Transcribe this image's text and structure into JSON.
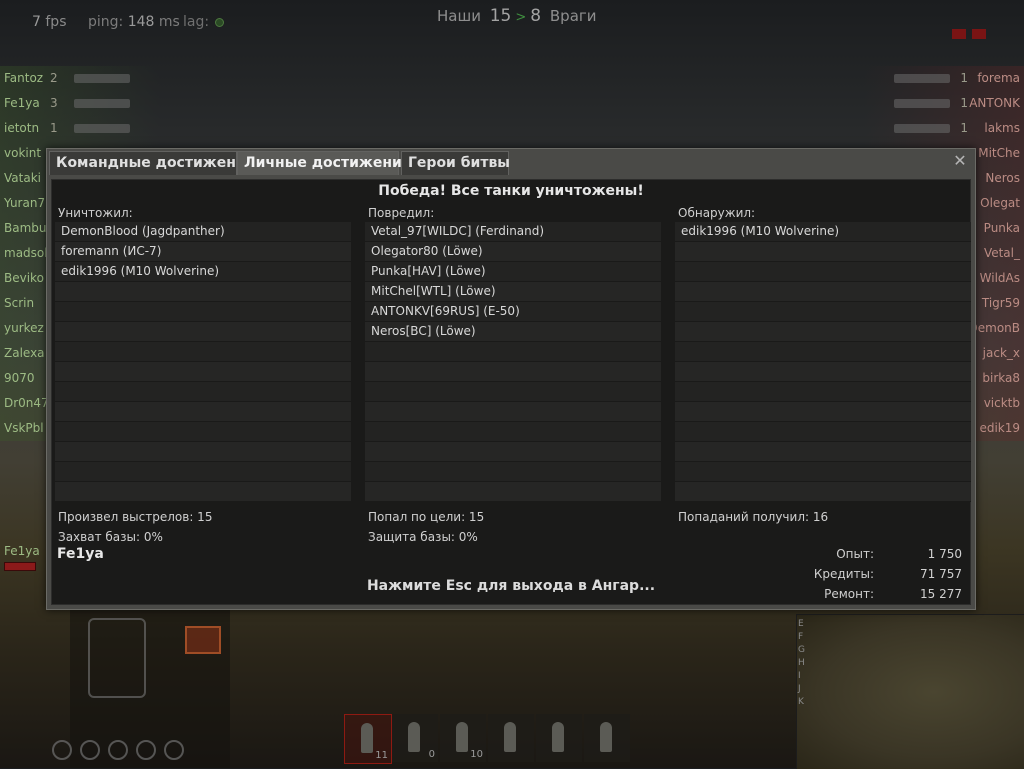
{
  "hud": {
    "fps_value": "7",
    "fps_label": "fps",
    "ping_label": "ping:",
    "ping_value": "148",
    "ping_unit": "ms",
    "lag_label": "lag:",
    "score_allies_label": "Наши",
    "score_allies": "15",
    "score_arrow": ">",
    "score_enemies": "8",
    "score_enemies_label": "Враги"
  },
  "allies": [
    {
      "name": "Fantoz",
      "frags": "2"
    },
    {
      "name": "Fe1ya",
      "frags": "3"
    },
    {
      "name": "ietotn",
      "frags": "1"
    },
    {
      "name": "vokint",
      "frags": ""
    },
    {
      "name": "Vataki",
      "frags": ""
    },
    {
      "name": "Yuran7",
      "frags": ""
    },
    {
      "name": "Bambuk",
      "frags": ""
    },
    {
      "name": "madsol",
      "frags": ""
    },
    {
      "name": "Beviko",
      "frags": ""
    },
    {
      "name": "Scrin",
      "frags": ""
    },
    {
      "name": "yurkez",
      "frags": ""
    },
    {
      "name": "Zalexa",
      "frags": ""
    },
    {
      "name": "9070",
      "frags": ""
    },
    {
      "name": "Dr0n47",
      "frags": ""
    },
    {
      "name": "VskPbl",
      "frags": ""
    }
  ],
  "enemies": [
    {
      "name": "forema",
      "frags": "1"
    },
    {
      "name": "ANTONK",
      "frags": "1"
    },
    {
      "name": "lakms",
      "frags": "1"
    },
    {
      "name": "MitChe",
      "frags": ""
    },
    {
      "name": "Neros",
      "frags": ""
    },
    {
      "name": "Olegat",
      "frags": ""
    },
    {
      "name": "Punka",
      "frags": ""
    },
    {
      "name": "Vetal_",
      "frags": ""
    },
    {
      "name": "WildAs",
      "frags": ""
    },
    {
      "name": "Tigr59",
      "frags": ""
    },
    {
      "name": "DemonB",
      "frags": ""
    },
    {
      "name": "jack_x",
      "frags": ""
    },
    {
      "name": "birka8",
      "frags": ""
    },
    {
      "name": "vicktb",
      "frags": ""
    },
    {
      "name": "edik19",
      "frags": ""
    }
  ],
  "own_vehicle_name": "Fe1ya",
  "ammo": [
    {
      "count": "11",
      "active": true
    },
    {
      "count": "0",
      "active": false
    },
    {
      "count": "10",
      "active": false
    },
    {
      "count": "",
      "active": false
    },
    {
      "count": "",
      "active": false
    },
    {
      "count": "",
      "active": false
    }
  ],
  "minimap_letters": [
    "E",
    "F",
    "G",
    "H",
    "I",
    "J",
    "K"
  ],
  "dialog": {
    "tabs": [
      "Командные достижения",
      "Личные достижения",
      "Герои битвы"
    ],
    "active_tab": 1,
    "close_glyph": "✕",
    "result_title": "Победа! Все танки уничтожены!",
    "destroyed_label": "Уничтожил:",
    "destroyed": [
      "DemonBlood (Jagdpanther)",
      "foremann (ИС-7)",
      "edik1996 (M10 Wolverine)"
    ],
    "damaged_label": "Повредил:",
    "damaged": [
      "Vetal_97[WILDC] (Ferdinand)",
      "Olegator80 (Löwe)",
      "Punka[HAV] (Löwe)",
      "MitChel[WTL] (Löwe)",
      "ANTONKV[69RUS] (E-50)",
      "Neros[BC] (Löwe)"
    ],
    "spotted_label": "Обнаружил:",
    "spotted": [
      "edik1996 (M10 Wolverine)"
    ],
    "shots_fired": "Произвел выстрелов: 15",
    "base_capture": "Захват базы: 0%",
    "hits": "Попал по цели: 15",
    "base_defense": "Защита базы: 0%",
    "hits_received": "Попаданий получил: 16",
    "player_name": "Fe1ya",
    "experience_label": "Опыт:",
    "experience_value": "1 750",
    "credits_label": "Кредиты:",
    "credits_value": "71 757",
    "repair_label": "Ремонт:",
    "repair_value": "15 277",
    "esc_message": "Нажмите Esc для выхода в Ангар..."
  }
}
